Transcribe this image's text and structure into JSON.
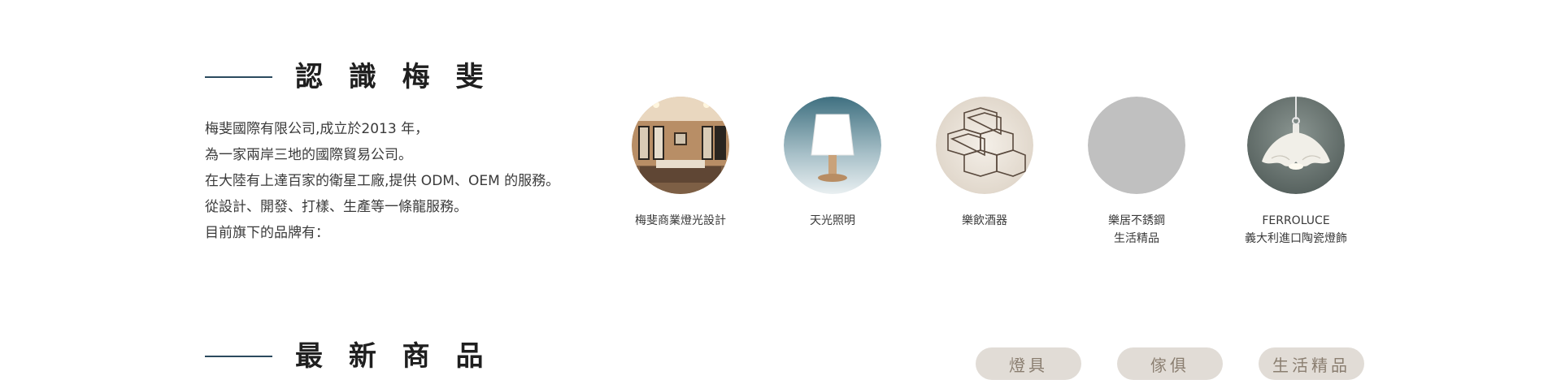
{
  "about": {
    "heading": "認 識 梅 斐",
    "lines": [
      "梅斐國際有限公司,成立於2013 年，",
      "為一家兩岸三地的國際貿易公司。",
      "在大陸有上達百家的衛星工廠,提供 ODM、OEM 的服務。",
      "從設計、開發、打樣、生產等一條龍服務。",
      "目前旗下的品牌有："
    ]
  },
  "brands": [
    {
      "line1": "梅斐商業燈光設計",
      "line2": "",
      "image": "interior-room-photo"
    },
    {
      "line1": "天光照明",
      "line2": "",
      "image": "table-lamp-photo"
    },
    {
      "line1": "樂飲酒器",
      "line2": "",
      "image": "hexagon-wine-rack-photo"
    },
    {
      "line1": "樂居不銹鋼",
      "line2": "生活精品",
      "image": "placeholder-gray"
    },
    {
      "line1": "FERROLUCE",
      "line2": "義大利進口陶瓷燈飾",
      "image": "ceramic-pendant-lamp-photo"
    }
  ],
  "products": {
    "heading": "最 新 商 品",
    "tabs": [
      "燈具",
      "傢俱",
      "生活精品"
    ]
  },
  "colors": {
    "heading_rule": "#2b4a5e",
    "tab_background": "#e1dcd6",
    "tab_text": "#8a7e70",
    "placeholder_circle": "#c0c0c0"
  }
}
